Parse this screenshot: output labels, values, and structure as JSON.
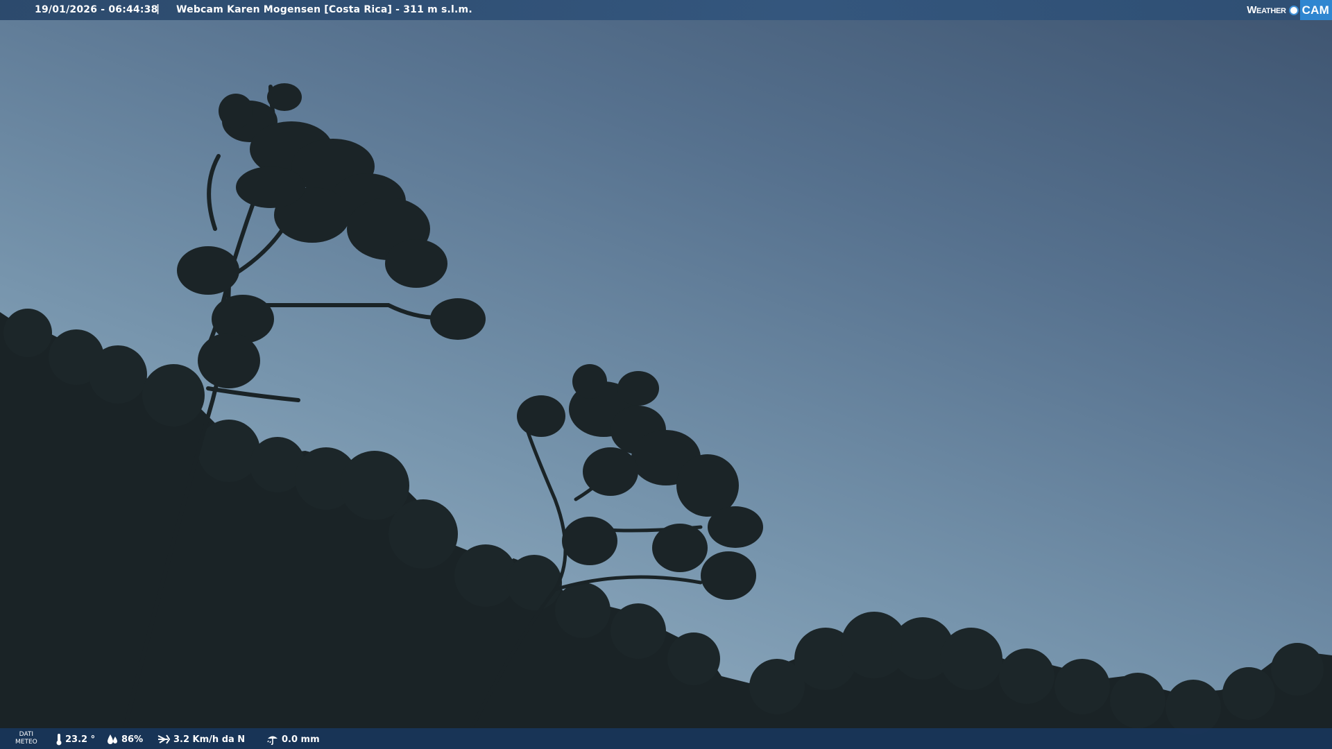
{
  "header": {
    "datetime": "19/01/2026 - 06:44:38",
    "separator": "|",
    "camera_title": "Webcam Karen Mogensen [Costa Rica]  - 311 m s.l.m."
  },
  "brand": {
    "weather_label": "Weather",
    "cam_label": "CAM",
    "accent_color": "#2f86d0"
  },
  "footer": {
    "dati_line1": "DATI",
    "dati_line2": "METEO",
    "temperature": "23.2 °",
    "humidity": "86%",
    "wind": "3.2 Km/h da N",
    "rain": "0.0 mm",
    "icons": [
      "thermometer-icon",
      "humidity-icon",
      "wind-icon",
      "rain-gauge-icon"
    ]
  },
  "scene": {
    "sky_top_color": "#3e5470",
    "sky_bottom_color": "#a3bacb",
    "vegetation_color": "#1a2326"
  }
}
